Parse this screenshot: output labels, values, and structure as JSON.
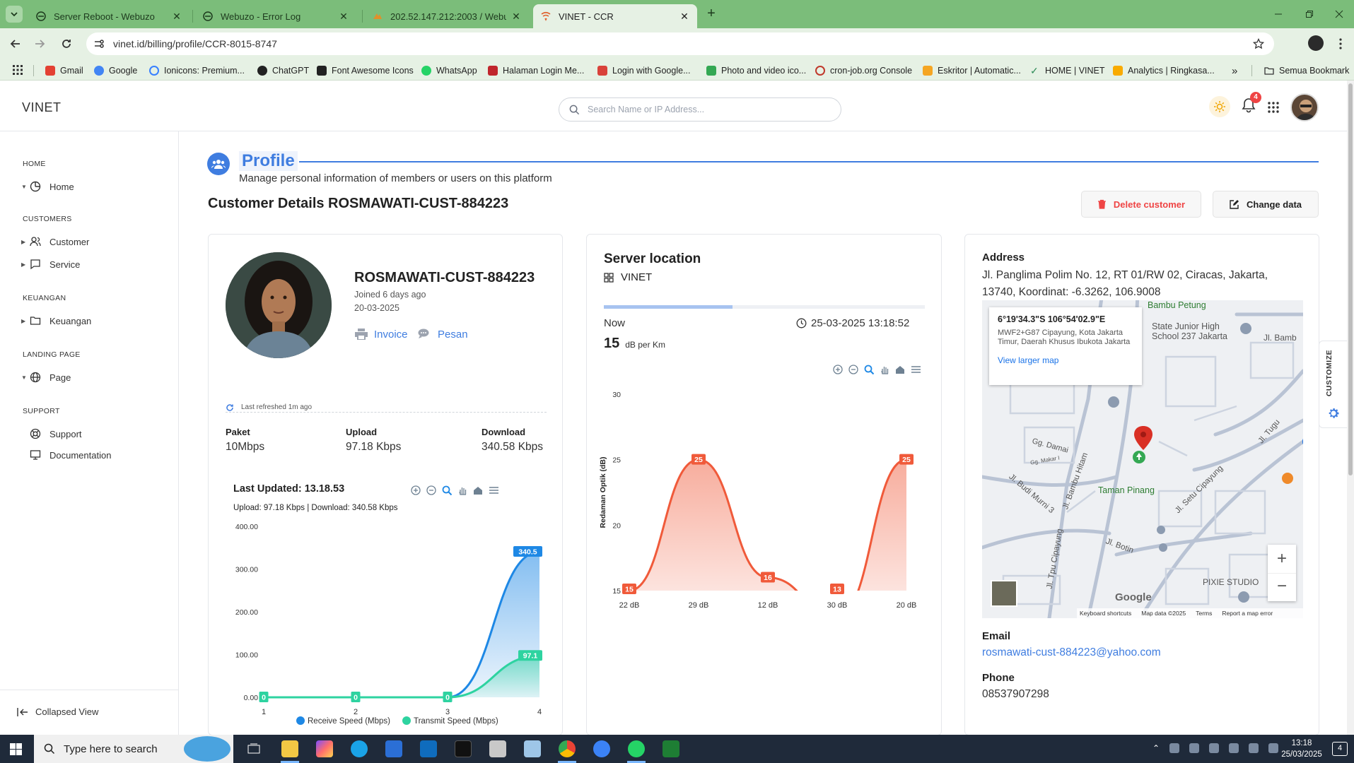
{
  "browser": {
    "tabs": [
      {
        "title": "Server Reboot - Webuzo"
      },
      {
        "title": "Webuzo - Error Log"
      },
      {
        "title": "202.52.147.212:2003 / Webuzo"
      },
      {
        "title": "VINET - CCR"
      }
    ],
    "url": "vinet.id/billing/profile/CCR-8015-8747",
    "bookmarks": [
      "Gmail",
      "Google",
      "Ionicons: Premium...",
      "ChatGPT",
      "Font Awesome Icons",
      "WhatsApp",
      "Halaman Login Me...",
      "Login with Google...",
      "Photo and video ico...",
      "cron-job.org Console",
      "Eskritor | Automatic...",
      "HOME | VINET",
      "Analytics | Ringkasa..."
    ],
    "all_bookmarks": "Semua Bookmark",
    "more": "»"
  },
  "header": {
    "logo": "VINET",
    "search_placeholder": "Search Name or IP Address...",
    "notification_count": "4"
  },
  "sidebar": {
    "sections": [
      {
        "title": "HOME",
        "items": [
          {
            "label": "Home"
          }
        ]
      },
      {
        "title": "CUSTOMERS",
        "items": [
          {
            "label": "Customer"
          },
          {
            "label": "Service"
          }
        ]
      },
      {
        "title": "KEUANGAN",
        "items": [
          {
            "label": "Keuangan"
          }
        ]
      },
      {
        "title": "LANDING PAGE",
        "items": [
          {
            "label": "Page"
          }
        ]
      },
      {
        "title": "SUPPORT",
        "items": [
          {
            "label": "Support"
          },
          {
            "label": "Documentation"
          }
        ]
      }
    ],
    "collapsed_view": "Collapsed View"
  },
  "page": {
    "title": "Profile",
    "subtitle": "Manage personal information of members or users on this platform",
    "customer_title": "Customer Details ROSMAWATI-CUST-884223",
    "delete_label": "Delete customer",
    "change_label": "Change data",
    "customize": "CUSTOMIZE"
  },
  "profile": {
    "name": "ROSMAWATI-CUST-884223",
    "joined": "Joined 6 days ago",
    "date": "20-03-2025",
    "invoice": "Invoice",
    "pesan": "Pesan",
    "refreshed": "Last refreshed 1m ago",
    "paket_label": "Paket",
    "paket": "10Mbps",
    "upload_label": "Upload",
    "upload": "97.18 Kbps",
    "download_label": "Download",
    "download": "340.58 Kbps",
    "chart_title": "Last Updated: 13.18.53",
    "chart_subtitle": "Upload: 97.18 Kbps | Download: 340.58 Kbps"
  },
  "server": {
    "title": "Server location",
    "name": "VINET",
    "progress": 0.4,
    "now_label": "Now",
    "datetime": "25-03-2025 13:18:52",
    "value": "15",
    "unit": "dB per Km"
  },
  "address": {
    "label": "Address",
    "value": "Jl. Panglima Polim No. 12, RT 01/RW 02, Ciracas, Jakarta, 13740, Koordinat: -6.3262, 106.9008",
    "email_label": "Email",
    "email": "rosmawati-cust-884223@yahoo.com",
    "phone_label": "Phone",
    "phone": "08537907298"
  },
  "map": {
    "coords": "6°19'34.3\"S 106°54'02.9\"E",
    "place": "MWF2+G87 Cipayung, Kota Jakarta Timur, Daerah Khusus Ibukota Jakarta",
    "larger": "View larger map",
    "labels": [
      "Bambu Petung",
      "State Junior High School 237 Jakarta",
      "Jl. Bamb",
      "Gg. Damai",
      "Gg. Makar I",
      "Jl. Bambu Hitam",
      "Jl. Budi Murni 3",
      "Taman Pinang",
      "Jl. Setu Cipayung",
      "Jl. Tugu",
      "Jl. Botin",
      "Jl. Tpu Cipayung",
      "PIXIE STUDIO",
      "Google",
      "Keyboard shortcuts",
      "Map data ©2025",
      "Terms",
      "Report a map error"
    ]
  },
  "taskbar": {
    "search": "Type here to search",
    "time": "13:18",
    "date": "25/03/2025",
    "notif": "4"
  },
  "chart_data": [
    {
      "type": "area",
      "title": "Last Updated: 13.18.53",
      "subtitle": "Upload: 97.18 Kbps | Download: 340.58 Kbps",
      "x": [
        1,
        2,
        3,
        4
      ],
      "ylim": [
        0,
        400
      ],
      "yticks": [
        "0.00",
        "100.00",
        "200.00",
        "300.00",
        "400.00"
      ],
      "series": [
        {
          "name": "Receive Speed (Mbps)",
          "values": [
            0,
            0,
            0,
            340.58
          ],
          "labels": [
            "0",
            "0",
            "0",
            "340.5"
          ],
          "color": "#1e88e5"
        },
        {
          "name": "Transmit Speed (Mbps)",
          "values": [
            0,
            0,
            0,
            97.18
          ],
          "labels": [
            "0",
            "0",
            "0",
            "97.1"
          ],
          "color": "#2ed3a0"
        }
      ],
      "legend": "bottom"
    },
    {
      "type": "area",
      "categories": [
        "22 dB",
        "29 dB",
        "12 dB",
        "30 dB",
        "20 dB"
      ],
      "values": [
        15,
        25,
        16,
        13,
        25
      ],
      "ylim": [
        15,
        30
      ],
      "yticks": [
        "15",
        "20",
        "25",
        "30"
      ],
      "ylabel": "Redaman Optik (dB)",
      "color": "#f05a3a"
    }
  ]
}
